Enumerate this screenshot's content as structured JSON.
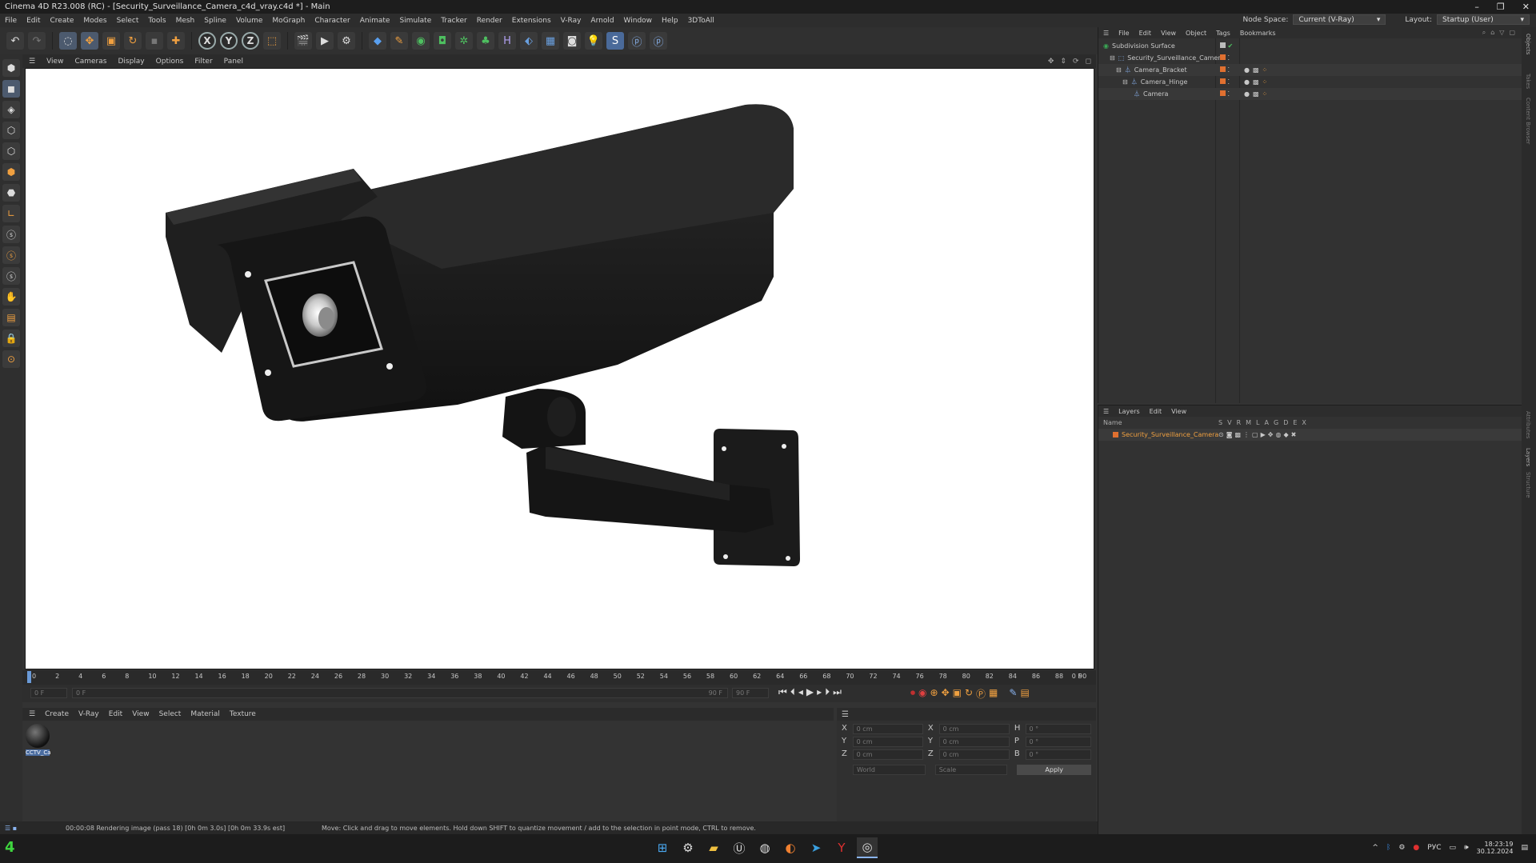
{
  "window": {
    "title": "Cinema 4D R23.008 (RC) - [Security_Surveillance_Camera_c4d_vray.c4d *] - Main",
    "controls": [
      "–",
      "❐",
      "✕"
    ]
  },
  "menu": {
    "items": [
      "File",
      "Edit",
      "Create",
      "Modes",
      "Select",
      "Tools",
      "Mesh",
      "Spline",
      "Volume",
      "MoGraph",
      "Character",
      "Animate",
      "Simulate",
      "Tracker",
      "Render",
      "Extensions",
      "V-Ray",
      "Arnold",
      "Window",
      "Help",
      "3DToAll"
    ],
    "node_space_label": "Node Space:",
    "node_space_value": "Current (V-Ray)",
    "layout_label": "Layout:",
    "layout_value": "Startup (User)"
  },
  "toolbar": {
    "axes": [
      "X",
      "Y",
      "Z"
    ]
  },
  "viewport_menu": [
    "View",
    "Cameras",
    "Display",
    "Options",
    "Filter",
    "Panel"
  ],
  "timeline": {
    "ticks": [
      "0",
      "2",
      "4",
      "6",
      "8",
      "10",
      "12",
      "14",
      "16",
      "18",
      "20",
      "22",
      "24",
      "26",
      "28",
      "30",
      "32",
      "34",
      "36",
      "38",
      "40",
      "42",
      "44",
      "46",
      "48",
      "50",
      "52",
      "54",
      "56",
      "58",
      "60",
      "62",
      "64",
      "66",
      "68",
      "70",
      "72",
      "74",
      "76",
      "78",
      "80",
      "82",
      "84",
      "86",
      "88",
      "90"
    ],
    "frame_end_label": "0 F",
    "current_frame": "0 F",
    "start_field": "0 F",
    "end_field": "90 F",
    "end_field2": "90 F"
  },
  "material_menu": [
    "Create",
    "V-Ray",
    "Edit",
    "View",
    "Select",
    "Material",
    "Texture"
  ],
  "material": {
    "label": "CCTV_Ca"
  },
  "coords": {
    "rows": [
      {
        "a": "X",
        "av": "0 cm",
        "b": "X",
        "bv": "0 cm",
        "c": "H",
        "cv": "0 °"
      },
      {
        "a": "Y",
        "av": "0 cm",
        "b": "Y",
        "bv": "0 cm",
        "c": "P",
        "cv": "0 °"
      },
      {
        "a": "Z",
        "av": "0 cm",
        "b": "Z",
        "bv": "0 cm",
        "c": "B",
        "cv": "0 °"
      }
    ],
    "mode": "World",
    "scale": "Scale",
    "apply": "Apply"
  },
  "status": {
    "left": "00:00:08 Rendering image (pass 18) [0h 0m 3.0s] [0h 0m 33.9s est]",
    "right": "Move: Click and drag to move elements. Hold down SHIFT to quantize movement / add to the selection in point mode, CTRL to remove."
  },
  "objects_menu": [
    "File",
    "Edit",
    "View",
    "Object",
    "Tags",
    "Bookmarks"
  ],
  "objects": [
    {
      "name": "Subdivision Surface",
      "indent": 0,
      "color": "#3aa855"
    },
    {
      "name": "Security_Surveillance_Camera",
      "indent": 1,
      "color": "#e07030"
    },
    {
      "name": "Camera_Bracket",
      "indent": 2,
      "color": "#e07030"
    },
    {
      "name": "Camera_Hinge",
      "indent": 3,
      "color": "#e07030"
    },
    {
      "name": "Camera",
      "indent": 4,
      "color": "#e07030"
    }
  ],
  "layers_menu": [
    "Layers",
    "Edit",
    "View"
  ],
  "layers": {
    "header_name": "Name",
    "header_flags": [
      "S",
      "V",
      "R",
      "M",
      "L",
      "A",
      "G",
      "D",
      "E",
      "X"
    ],
    "rows": [
      {
        "name": "Security_Surveillance_Camera",
        "color": "#e07030"
      }
    ]
  },
  "right_tabs": [
    "Objects",
    "Takes",
    "Content Browser",
    "Attributes",
    "Layers",
    "Structure"
  ],
  "taskbar": {
    "badge": "4",
    "lang": "РУС",
    "time": "18:23:19",
    "date": "30.12.2024"
  }
}
